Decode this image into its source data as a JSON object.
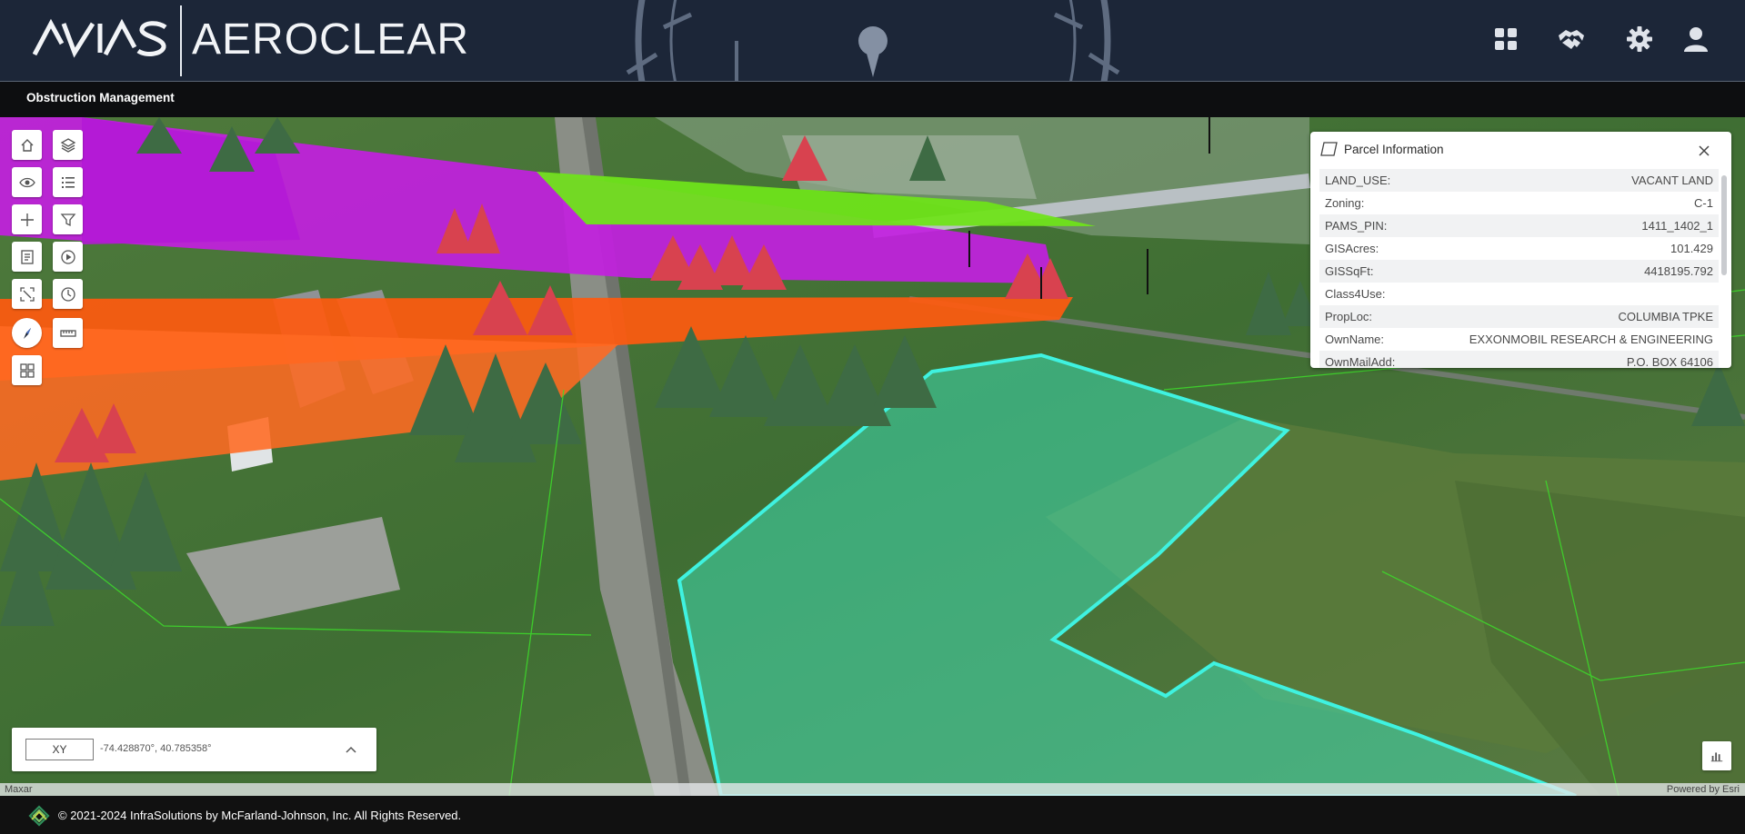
{
  "app": {
    "brand_mark": "AVIAS",
    "product_name": "AEROCLEAR",
    "module_title": "Obstruction Management"
  },
  "header_icons": [
    "apps-grid-icon",
    "handshake-icon",
    "gear-icon",
    "user-icon"
  ],
  "toolbar": {
    "tools": [
      "home-icon",
      "layers-icon",
      "visibility-icon",
      "legend-list-icon",
      "crosshair-icon",
      "filter-icon",
      "report-document-icon",
      "play-icon",
      "fullscreen-icon",
      "clock-icon",
      "compass-icon",
      "measure-icon",
      "basemap-gallery-icon"
    ]
  },
  "parcel_panel": {
    "title": "Parcel Information",
    "rows": [
      {
        "key": "LAND_USE:",
        "value": "VACANT LAND"
      },
      {
        "key": "Zoning:",
        "value": "C-1"
      },
      {
        "key": "PAMS_PIN:",
        "value": "1411_1402_1"
      },
      {
        "key": "GISAcres:",
        "value": "101.429"
      },
      {
        "key": "GISSqFt:",
        "value": "4418195.792"
      },
      {
        "key": "Class4Use:",
        "value": ""
      },
      {
        "key": "PropLoc:",
        "value": "COLUMBIA TPKE"
      },
      {
        "key": "OwnName:",
        "value": "EXXONMOBIL RESEARCH & ENGINEERING"
      },
      {
        "key": "OwnMailAdd:",
        "value": "P.O. BOX 64106"
      }
    ]
  },
  "coordinates": {
    "format": "XY",
    "value": "-74.428870°, 40.785358°"
  },
  "attribution": {
    "left": "Maxar",
    "right": "Powered by Esri"
  },
  "footer": {
    "copyright": "© 2021-2024 InfraSolutions by McFarland-Johnson, Inc. All Rights Reserved."
  },
  "colors": {
    "header_bg": "#1c2638",
    "surface_magenta": "#c21fe0",
    "surface_green": "#6fe31a",
    "surface_orange": "#ff5a0f",
    "parcel_highlight": "#3ff2e0",
    "tree_red": "#d8424f",
    "tree_green": "#3e6b44"
  }
}
